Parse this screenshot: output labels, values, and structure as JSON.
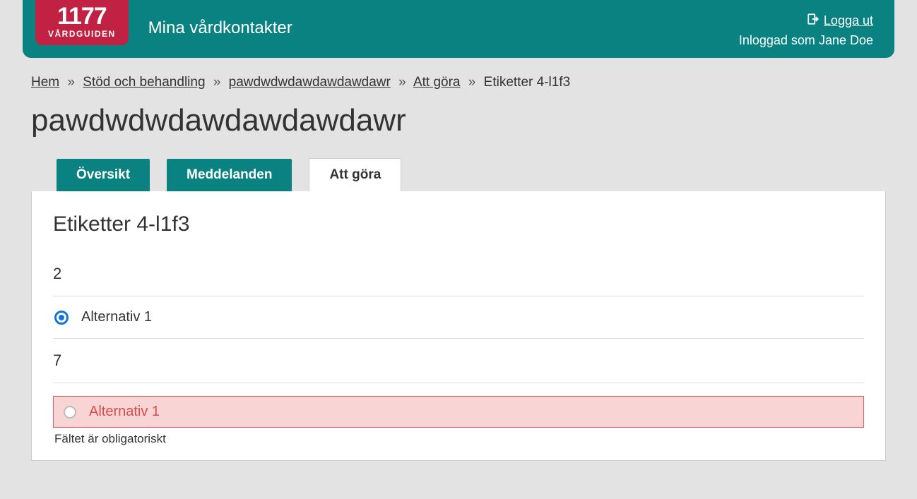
{
  "header": {
    "logo_number": "1177",
    "logo_subtitle": "VÅRDGUIDEN",
    "site_title": "Mina vårdkontakter",
    "logout_label": "Logga ut",
    "logged_in_prefix": "Inloggad som ",
    "user_name": "Jane Doe"
  },
  "breadcrumb": {
    "items": [
      {
        "label": "Hem",
        "link": true
      },
      {
        "label": "Stöd och behandling",
        "link": true
      },
      {
        "label": "pawdwdwdawdawdawdawr",
        "link": true
      },
      {
        "label": "Att göra",
        "link": true
      },
      {
        "label": "Etiketter 4-l1f3",
        "link": false
      }
    ],
    "separator": "»"
  },
  "page": {
    "title": "pawdwdwdawdawdawdawr"
  },
  "tabs": [
    {
      "label": "Översikt",
      "active": false
    },
    {
      "label": "Meddelanden",
      "active": false
    },
    {
      "label": "Att göra",
      "active": true
    }
  ],
  "form": {
    "section_title": "Etiketter 4-l1f3",
    "q1": {
      "label": "2",
      "option_label": "Alternativ 1"
    },
    "q2": {
      "label": "7",
      "option_label": "Alternativ 1",
      "error_message": "Fältet är obligatoriskt"
    }
  }
}
